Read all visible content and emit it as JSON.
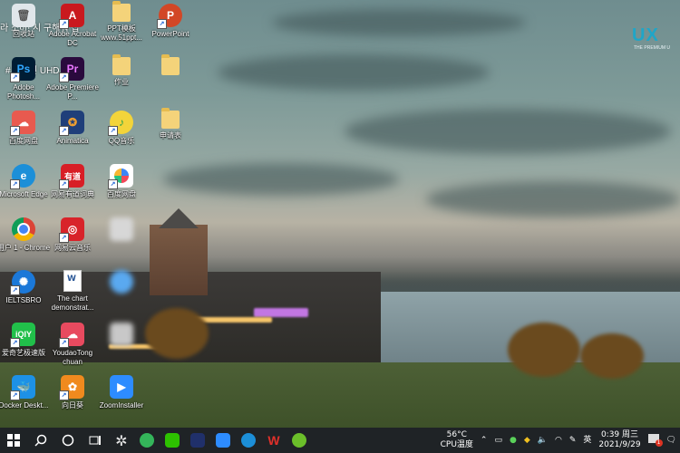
{
  "overlay_texts": {
    "top_line": "라 소비! 시                구해줘      집",
    "second_line": "#        8화 면              UHD"
  },
  "watermark": {
    "logo": "UX",
    "tagline": "THE PREMIUM U"
  },
  "desktop_icons": [
    {
      "name": "recycle-bin",
      "label": "回收站",
      "icon": "recycle-bin-icon"
    },
    {
      "name": "adobe-acrobat",
      "label": "Adobe Acrobat DC",
      "icon": "acrobat-icon",
      "color": "#c9191e"
    },
    {
      "name": "ppt-template",
      "label": "PPT模板 www.51ppt...",
      "icon": "folder-doc-icon"
    },
    {
      "name": "powerpoint",
      "label": "PowerPoint",
      "icon": "powerpoint-icon",
      "color": "#d24726"
    },
    {
      "name": "photoshop",
      "label": "Adobe Photosh...",
      "icon": "photoshop-icon",
      "color": "#001d34"
    },
    {
      "name": "premiere",
      "label": "Adobe Premiere P...",
      "icon": "premiere-icon",
      "color": "#2a0a3d"
    },
    {
      "name": "homework",
      "label": "作业",
      "icon": "folder-doc-icon"
    },
    {
      "name": "blurred-folder",
      "label": "",
      "icon": "folder-icon"
    },
    {
      "name": "baidu-netdisk",
      "label": "百度网盘",
      "icon": "netdisk-icon",
      "color": "#e85a4f"
    },
    {
      "name": "animatica",
      "label": "Animatica",
      "icon": "animatica-icon",
      "color": "#f0a030"
    },
    {
      "name": "qq-music",
      "label": "QQ音乐",
      "icon": "qqmusic-icon",
      "color": "#f3d43a"
    },
    {
      "name": "application-form",
      "label": "申请表",
      "icon": "folder-doc-icon"
    },
    {
      "name": "edge",
      "label": "Microsoft Edge",
      "icon": "edge-icon",
      "color": "#1c8fd8"
    },
    {
      "name": "youdao-dict",
      "label": "网易有道词典",
      "icon": "youdao-icon",
      "color": "#d81e26"
    },
    {
      "name": "baidu-photos",
      "label": "百度网盘",
      "icon": "photos-icon",
      "color": "#ffffff"
    },
    {
      "name": "chrome",
      "label": "用户 1 - Chrome",
      "icon": "chrome-icon",
      "color": "#ffffff"
    },
    {
      "name": "netease-music",
      "label": "网易云音乐",
      "icon": "netease-music-icon",
      "color": "#d8232a"
    },
    {
      "name": "ieltsbro",
      "label": "IELTSBRO",
      "icon": "ieltsbro-icon",
      "color": "#1b78d8"
    },
    {
      "name": "chart-doc",
      "label": "The chart demonstrat...",
      "icon": "word-doc-icon"
    },
    {
      "name": "iqiyi",
      "label": "爱奇艺极速版",
      "icon": "iqiyi-icon",
      "color": "#21c04a"
    },
    {
      "name": "youdao-tongchuan",
      "label": "YoudaoTong chuan",
      "icon": "cloud-icon",
      "color": "#e84a5f"
    },
    {
      "name": "docker",
      "label": "Docker Deskt...",
      "icon": "docker-icon",
      "color": "#1d91e6"
    },
    {
      "name": "sunflower",
      "label": "向日葵",
      "icon": "sunflower-icon",
      "color": "#f08a1e"
    },
    {
      "name": "zoom-installer",
      "label": "ZoomInstaller",
      "icon": "zoom-icon",
      "color": "#2d8cff"
    }
  ],
  "taskbar": {
    "start": "windows-start-icon",
    "search": "search-icon",
    "cortana": "cortana-icon",
    "taskview": "task-view-icon",
    "pinned": [
      {
        "name": "fan-app",
        "icon": "fan-icon",
        "color": "#e8e8e8"
      },
      {
        "name": "app-green",
        "icon": "green-app-icon",
        "color": "#34b55a"
      },
      {
        "name": "wechat",
        "icon": "wechat-icon",
        "color": "#2dc100"
      },
      {
        "name": "dark-app",
        "icon": "app-icon",
        "color": "#20306a"
      },
      {
        "name": "zoom",
        "icon": "zoom-icon",
        "color": "#2d8cff"
      },
      {
        "name": "edge",
        "icon": "edge-icon",
        "color": "#1c8fd8"
      },
      {
        "name": "wps",
        "icon": "wps-icon",
        "color": "#e0302a"
      },
      {
        "name": "360",
        "icon": "plus-icon",
        "color": "#6bbf2a"
      }
    ],
    "tray": {
      "cpu_temp": "56°C",
      "cpu_label": "CPU温度",
      "ime": "英",
      "time": "0:39 周三",
      "date": "2021/9/29",
      "notification_count": "1"
    }
  }
}
